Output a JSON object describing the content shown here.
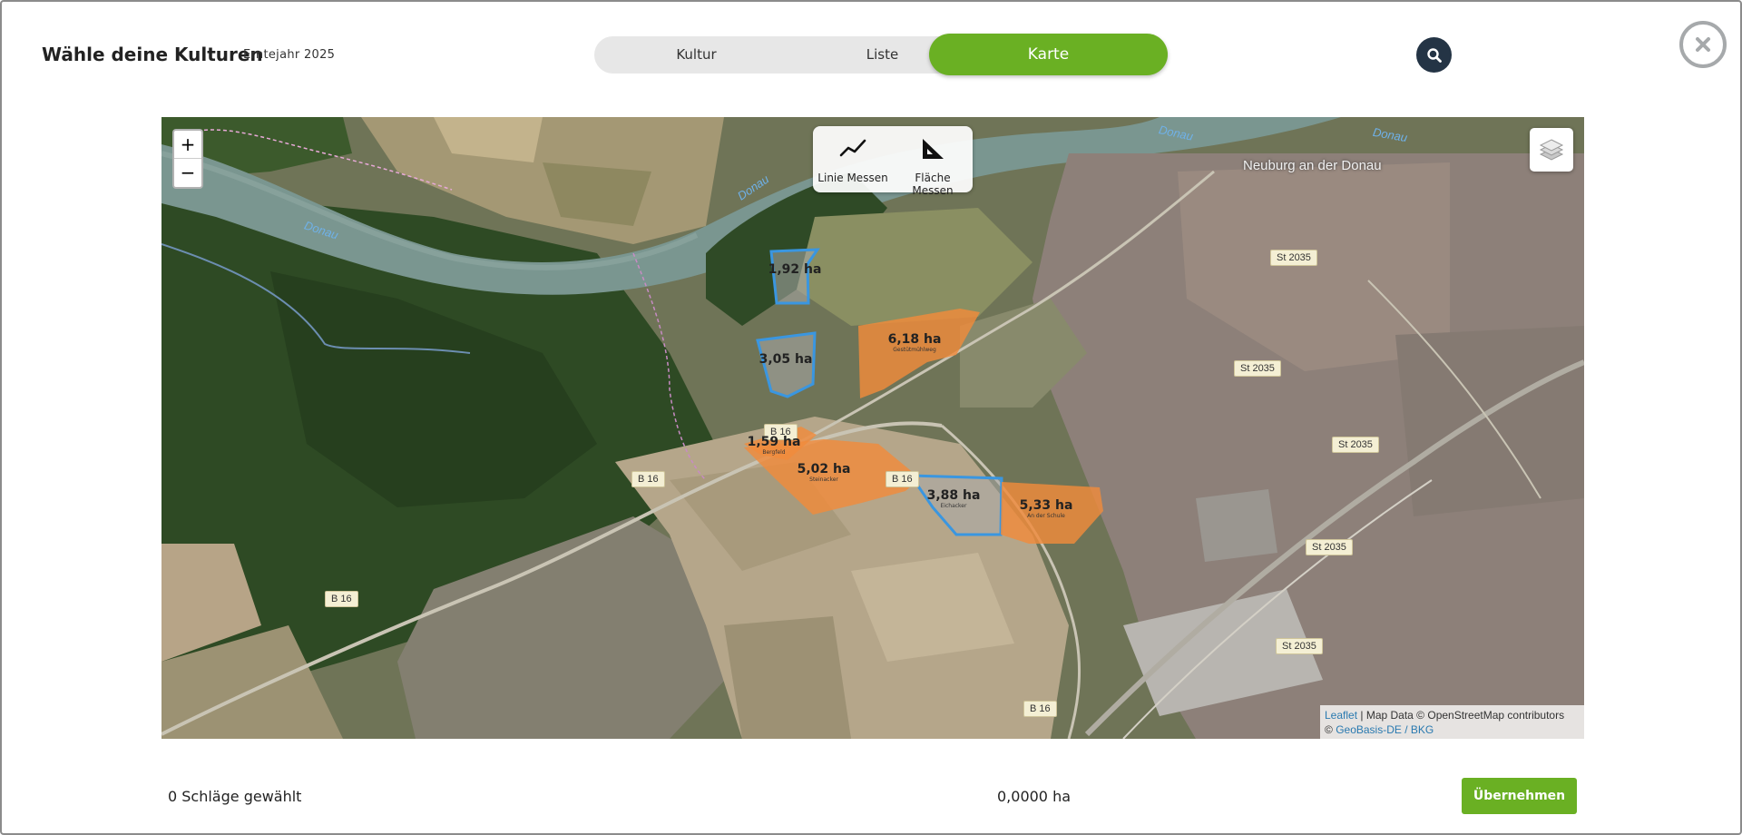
{
  "header": {
    "title": "Wähle deine Kulturen",
    "subtitle": "Erntejahr 2025"
  },
  "tabs": {
    "items": [
      {
        "label": "Kultur",
        "active": false
      },
      {
        "label": "Liste",
        "active": false
      },
      {
        "label": "Karte",
        "active": true
      }
    ]
  },
  "icons": {
    "search": "search-icon",
    "close": "close-icon",
    "layers": "layers-icon",
    "line_measure": "polyline-icon",
    "area_measure": "set-square-icon"
  },
  "map": {
    "zoom_in": "+",
    "zoom_out": "−",
    "measure": {
      "line": "Linie Messen",
      "area": "Fläche Messen"
    },
    "attribution": {
      "leaflet": "Leaflet",
      "map_data": "| Map Data © OpenStreetMap contributors",
      "copyright": "©",
      "geobasis": "GeoBasis-DE / BKG"
    },
    "place": "Neuburg an der Donau",
    "river_labels": [
      "Donau",
      "Donau",
      "Donau",
      "Donau"
    ],
    "road_labels": [
      "B 16",
      "B 16",
      "B 16",
      "B 16",
      "B 16",
      "St 2035",
      "St 2035",
      "St 2035",
      "St 2035",
      "St 2035"
    ],
    "fields": [
      {
        "area": "1,92 ha",
        "name": "",
        "selected": false
      },
      {
        "area": "3,05 ha",
        "name": "",
        "selected": false
      },
      {
        "area": "6,18 ha",
        "name": "Gestütmühlweg",
        "selected": true
      },
      {
        "area": "1,59 ha",
        "name": "Bergfeld",
        "selected": true
      },
      {
        "area": "5,02 ha",
        "name": "Steinacker",
        "selected": true
      },
      {
        "area": "3,88 ha",
        "name": "Eichacker",
        "selected": false
      },
      {
        "area": "5,33 ha",
        "name": "An der Schule",
        "selected": true
      }
    ]
  },
  "colors": {
    "accent": "#6ab023",
    "search_bg": "#243445",
    "selected_field": "#f08b3c",
    "unselected_outline": "#3a96e0"
  },
  "footer": {
    "selected_count": "0 Schläge gewählt",
    "total_area": "0,0000 ha",
    "apply_label": "Übernehmen"
  }
}
